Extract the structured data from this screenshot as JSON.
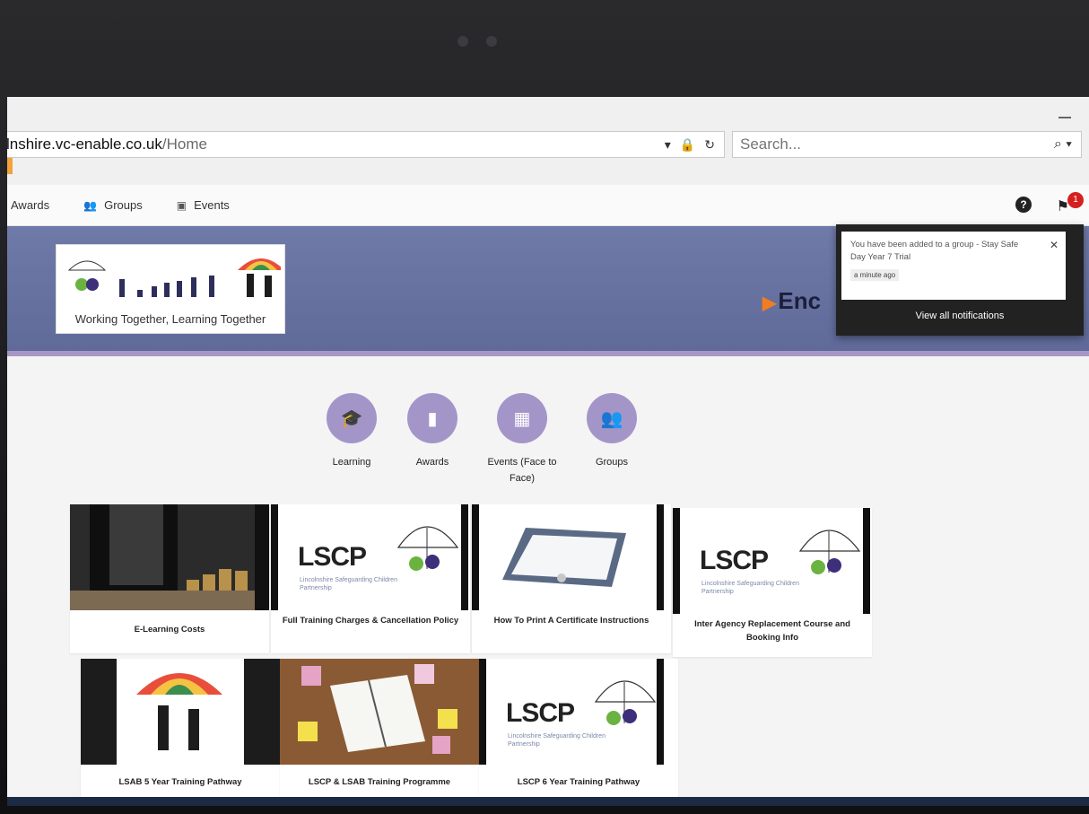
{
  "browser": {
    "url_host": "lnshire.vc-enable.co.uk",
    "url_path": "/Home",
    "search_placeholder": "Search..."
  },
  "nav": {
    "items": [
      {
        "label": "Awards",
        "icon": "award-icon"
      },
      {
        "label": "Groups",
        "icon": "groups-icon"
      },
      {
        "label": "Events",
        "icon": "calendar-icon"
      }
    ],
    "notification_count": "1"
  },
  "banner": {
    "tagline": "Working Together, Learning Together",
    "brand_text": "Enc"
  },
  "notification": {
    "message": "You have been added to a group - Stay Safe Day Year 7 Trial",
    "time": "a minute ago",
    "view_all": "View all notifications"
  },
  "quick_links": [
    {
      "label": "Learning",
      "icon": "graduation-cap-icon"
    },
    {
      "label": "Awards",
      "icon": "book-icon"
    },
    {
      "label": "Events (Face to Face)",
      "icon": "calendar-icon"
    },
    {
      "label": "Groups",
      "icon": "groups-icon"
    }
  ],
  "tiles": [
    {
      "caption": "E-Learning Costs"
    },
    {
      "caption": "Full Training Charges & Cancellation Policy",
      "logo": "LSCP",
      "logo_sub": "Lincolnshire Safeguarding Children Partnership"
    },
    {
      "caption": "How To Print A Certificate Instructions"
    },
    {
      "caption": "Inter Agency Replacement Course and Booking Info",
      "logo": "LSCP",
      "logo_sub": "Lincolnshire Safeguarding Children Partnership"
    },
    {
      "caption": "LSAB 5 Year Training Pathway"
    },
    {
      "caption": "LSCP & LSAB Training Programme"
    },
    {
      "caption": "LSCP 6 Year Training Pathway",
      "logo": "LSCP",
      "logo_sub": "Lincolnshire Safeguarding Children Partnership"
    }
  ],
  "colors": {
    "banner": "#6f7aa8",
    "accent_purple": "#a495c9",
    "badge_red": "#d42020",
    "brand_orange": "#f07d1f"
  }
}
